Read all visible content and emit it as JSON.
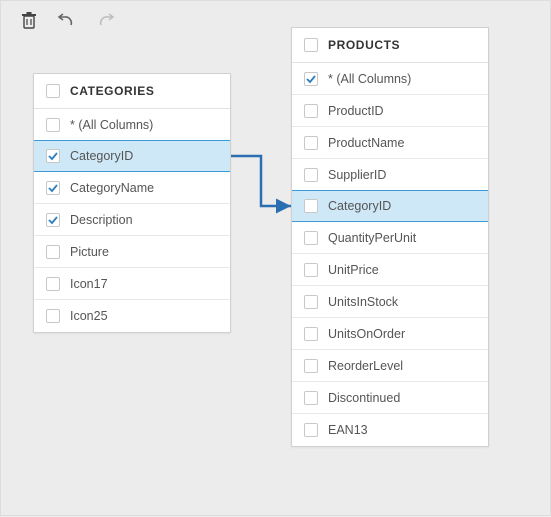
{
  "toolbar": {
    "delete": "Delete",
    "undo": "Undo",
    "redo": "Redo"
  },
  "tables": {
    "categories": {
      "title": "CATEGORIES",
      "items": [
        {
          "label": "* (All Columns)",
          "checked": false,
          "selected": false
        },
        {
          "label": "CategoryID",
          "checked": true,
          "selected": true
        },
        {
          "label": "CategoryName",
          "checked": true,
          "selected": false
        },
        {
          "label": "Description",
          "checked": true,
          "selected": false
        },
        {
          "label": "Picture",
          "checked": false,
          "selected": false
        },
        {
          "label": "Icon17",
          "checked": false,
          "selected": false
        },
        {
          "label": "Icon25",
          "checked": false,
          "selected": false
        }
      ]
    },
    "products": {
      "title": "PRODUCTS",
      "items": [
        {
          "label": "* (All Columns)",
          "checked": true,
          "selected": false
        },
        {
          "label": "ProductID",
          "checked": false,
          "selected": false
        },
        {
          "label": "ProductName",
          "checked": false,
          "selected": false
        },
        {
          "label": "SupplierID",
          "checked": false,
          "selected": false
        },
        {
          "label": "CategoryID",
          "checked": false,
          "selected": true
        },
        {
          "label": "QuantityPerUnit",
          "checked": false,
          "selected": false
        },
        {
          "label": "UnitPrice",
          "checked": false,
          "selected": false
        },
        {
          "label": "UnitsInStock",
          "checked": false,
          "selected": false
        },
        {
          "label": "UnitsOnOrder",
          "checked": false,
          "selected": false
        },
        {
          "label": "ReorderLevel",
          "checked": false,
          "selected": false
        },
        {
          "label": "Discontinued",
          "checked": false,
          "selected": false
        },
        {
          "label": "EAN13",
          "checked": false,
          "selected": false
        }
      ]
    }
  },
  "connector": {
    "from": "categories.CategoryID",
    "to": "products.CategoryID"
  }
}
